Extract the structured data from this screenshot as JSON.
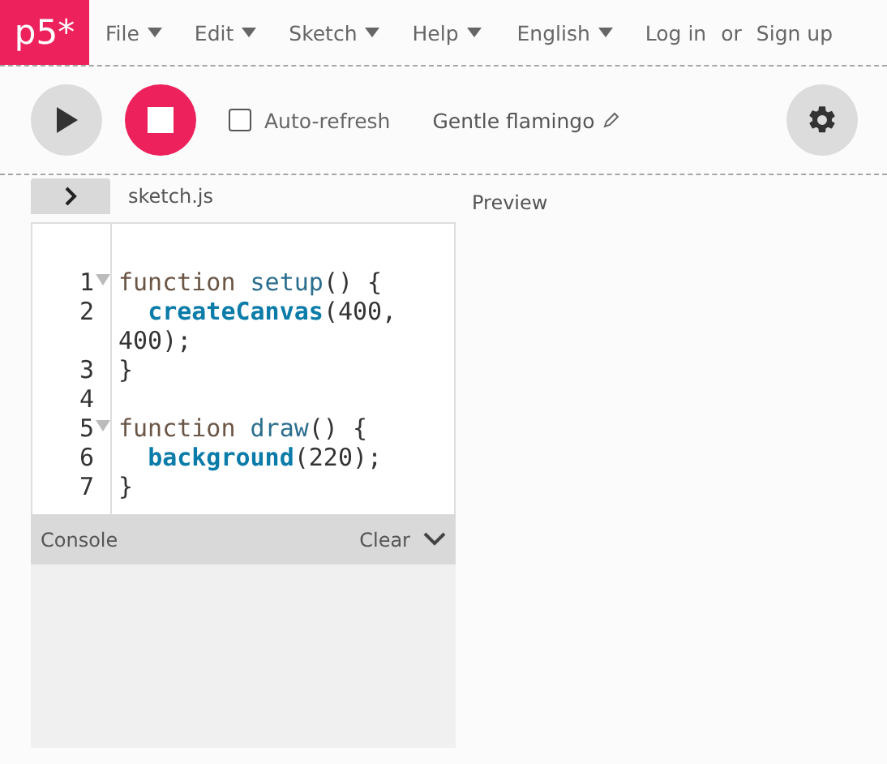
{
  "logo": "p5*",
  "menu": [
    {
      "label": "File"
    },
    {
      "label": "Edit"
    },
    {
      "label": "Sketch"
    },
    {
      "label": "Help"
    },
    {
      "label": "English"
    }
  ],
  "auth": {
    "login": "Log in",
    "separator": "or",
    "signup": "Sign up"
  },
  "toolbar": {
    "auto_refresh": {
      "label": "Auto-refresh",
      "checked": false
    },
    "sketch_name": "Gentle flamingo"
  },
  "editor": {
    "sidebar_open": false,
    "file_name": "sketch.js",
    "preview_label": "Preview",
    "lines": [
      {
        "number": "1",
        "fold": true,
        "tokens": [
          {
            "kind": "keyword",
            "text": "function"
          },
          {
            "kind": "name",
            "text": " setup"
          },
          {
            "kind": "plain",
            "text": "() {"
          }
        ]
      },
      {
        "number": "2",
        "fold": false,
        "tokens": [
          {
            "kind": "builtin",
            "text": "  createCanvas"
          },
          {
            "kind": "plain",
            "text": "(400, 400);"
          }
        ]
      },
      {
        "number": "3",
        "fold": false,
        "tokens": [
          {
            "kind": "plain",
            "text": "}"
          }
        ]
      },
      {
        "number": "4",
        "fold": false
      },
      {
        "number": "5",
        "fold": true,
        "tokens": [
          {
            "kind": "keyword",
            "text": "function"
          },
          {
            "kind": "name",
            "text": " draw"
          },
          {
            "kind": "plain",
            "text": "() {"
          }
        ]
      },
      {
        "number": "6",
        "fold": false,
        "tokens": [
          {
            "kind": "builtin",
            "text": "  background"
          },
          {
            "kind": "plain",
            "text": "(220);"
          }
        ]
      },
      {
        "number": "7",
        "fold": false,
        "tokens": [
          {
            "kind": "plain",
            "text": "}"
          }
        ]
      }
    ]
  },
  "console": {
    "title": "Console",
    "clear": "Clear"
  }
}
